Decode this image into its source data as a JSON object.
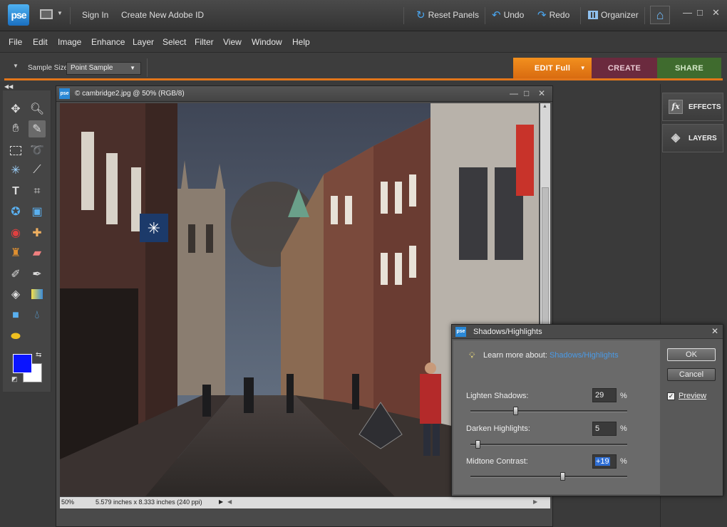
{
  "app": {
    "logo_text": "pse",
    "sign_in": "Sign In",
    "create_id": "Create New Adobe ID",
    "reset_panels": "Reset Panels",
    "undo": "Undo",
    "redo": "Redo",
    "organizer": "Organizer"
  },
  "menu": [
    "File",
    "Edit",
    "Image",
    "Enhance",
    "Layer",
    "Select",
    "Filter",
    "View",
    "Window",
    "Help"
  ],
  "options": {
    "sample_label": "Sample Size:",
    "sample_value": "Point Sample"
  },
  "modes": {
    "edit": "EDIT Full",
    "create": "CREATE",
    "share": "SHARE"
  },
  "document": {
    "title": "© cambridge2.jpg @ 50% (RGB/8)",
    "zoom": "50%",
    "dimensions": "5.579 inches x 8.333 inches (240 ppi)"
  },
  "panels": {
    "effects": "EFFECTS",
    "layers": "LAYERS"
  },
  "dialog": {
    "title": "Shadows/Highlights",
    "learn_prefix": "Learn more about:",
    "learn_link": "Shadows/Highlights",
    "ok": "OK",
    "cancel": "Cancel",
    "preview": "Preview",
    "preview_checked": true,
    "lighten_label": "Lighten Shadows:",
    "lighten_value": "29",
    "lighten_pct": 29,
    "darken_label": "Darken Highlights:",
    "darken_value": "5",
    "darken_pct": 5,
    "midtone_label": "Midtone Contrast:",
    "midtone_value": "+19",
    "midtone_pct": 59,
    "unit": "%"
  },
  "colors": {
    "foreground": "#0a14ff",
    "background": "#ffffff",
    "accent_orange": "#e2761a",
    "create_tab": "#6b2a3e",
    "share_tab": "#3f6b2e"
  }
}
